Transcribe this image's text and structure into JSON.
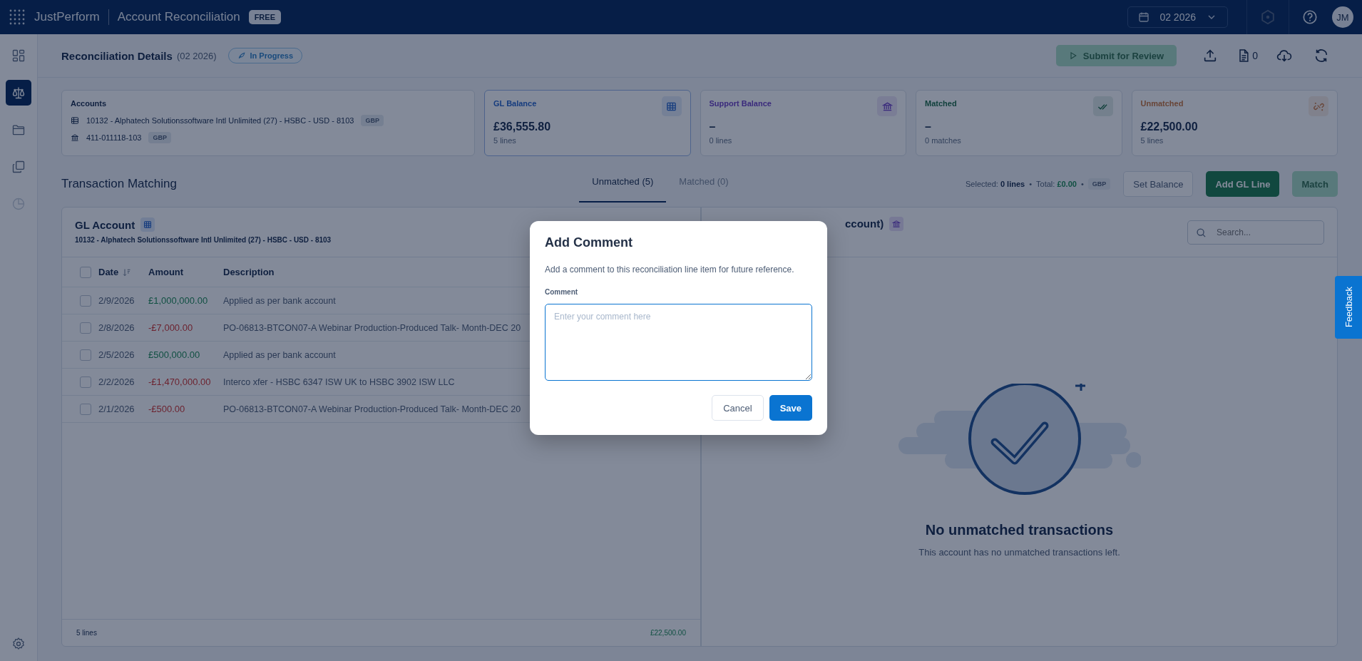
{
  "app": {
    "brand": "JustPerform",
    "title": "Account Reconciliation",
    "plan_badge": "FREE"
  },
  "period_picker": {
    "value": "02 2026"
  },
  "user": {
    "initials": "JM"
  },
  "sidebar": {
    "items": [
      {
        "kind": "dashboard",
        "selected": false,
        "disabled": false
      },
      {
        "kind": "scale",
        "selected": true,
        "disabled": false
      },
      {
        "kind": "folder",
        "selected": false,
        "disabled": false
      },
      {
        "kind": "copy",
        "selected": false,
        "disabled": false
      },
      {
        "kind": "pie",
        "selected": false,
        "disabled": true
      }
    ]
  },
  "header": {
    "title": "Reconciliation Details",
    "period": "(02 2026)",
    "status": "In Progress",
    "submit": {
      "label": "Submit for Review",
      "disabled": true
    },
    "documents_count": "0"
  },
  "accounts": {
    "label": "Accounts",
    "items": [
      {
        "kind": "ledger",
        "name": "10132 - Alphatech Solutionssoftware Intl Unlimited (27) - HSBC - USD - 8103",
        "currency": "GBP"
      },
      {
        "kind": "bank",
        "name": "411-011118-103",
        "currency": "GBP"
      }
    ]
  },
  "balance_cards": [
    {
      "kind": "gl",
      "label": "GL Balance",
      "value": "£36,555.80",
      "detail": "5 lines"
    },
    {
      "kind": "support",
      "label": "Support Balance",
      "value": "–",
      "detail": "0 lines"
    },
    {
      "kind": "matched",
      "label": "Matched",
      "value": "–",
      "detail": "0 matches"
    },
    {
      "kind": "unmatched",
      "label": "Unmatched",
      "value": "£22,500.00",
      "detail": "5 lines"
    }
  ],
  "matching": {
    "title": "Transaction Matching",
    "tabs": [
      {
        "label": "Unmatched (5)",
        "selected": true
      },
      {
        "label": "Matched (0)",
        "selected": false
      }
    ],
    "selection": {
      "label": "Selected:",
      "lines": "0 lines",
      "separator_1": "•",
      "total_label": "Total:",
      "total": "£0.00",
      "separator_2": "•",
      "currency": "GBP"
    },
    "buttons": [
      {
        "kind": "outline",
        "label": "Set Balance",
        "disabled": false
      },
      {
        "kind": "primary",
        "label": "Add GL Line",
        "disabled": false
      },
      {
        "kind": "primary",
        "label": "Match",
        "disabled": true
      }
    ]
  },
  "gl_panel": {
    "title": "GL Account",
    "subtitle": "10132 - Alphatech Solutionssoftware Intl Unlimited (27) - HSBC - USD - 8103",
    "all_checked": false,
    "columns": [
      {
        "label": "Date",
        "sortable": true
      },
      {
        "label": "Amount",
        "sortable": false
      },
      {
        "label": "Description",
        "sortable": false
      }
    ],
    "rows": [
      {
        "date": "2/9/2026",
        "amount": "£1,000,000.00",
        "kind": "in",
        "description": "Applied as per bank account",
        "checked": false
      },
      {
        "date": "2/8/2026",
        "amount": "-£7,000.00",
        "kind": "out",
        "description": "PO-06813-BTCON07-A Webinar Production-Produced Talk- Month-DEC 20",
        "checked": false
      },
      {
        "date": "2/5/2026",
        "amount": "£500,000.00",
        "kind": "in",
        "description": "Applied as per bank account",
        "checked": false
      },
      {
        "date": "2/2/2026",
        "amount": "-£1,470,000.00",
        "kind": "out",
        "description": "Interco xfer - HSBC 6347 ISW UK to HSBC 3902 ISW LLC",
        "checked": false
      },
      {
        "date": "2/1/2026",
        "amount": "-£500.00",
        "kind": "out",
        "description": "PO-06813-BTCON07-A Webinar Production-Produced Talk- Month-DEC 20",
        "checked": false
      }
    ],
    "footer": {
      "count": "5 lines",
      "total": "£22,500.00"
    }
  },
  "support_panel": {
    "title": "ccount)",
    "search": {
      "placeholder": "Search..."
    },
    "empty": {
      "title": "No unmatched transactions",
      "message": "This account has no unmatched transactions left."
    }
  },
  "dialog": {
    "title": "Add Comment",
    "description": "Add a comment to this reconciliation line item for future reference.",
    "field_label": "Comment",
    "placeholder": "Enter your comment here",
    "buttons": [
      {
        "kind": "secondary",
        "label": "Cancel"
      },
      {
        "kind": "primary",
        "label": "Save"
      }
    ]
  },
  "feedback": {
    "label": "Feedback"
  }
}
